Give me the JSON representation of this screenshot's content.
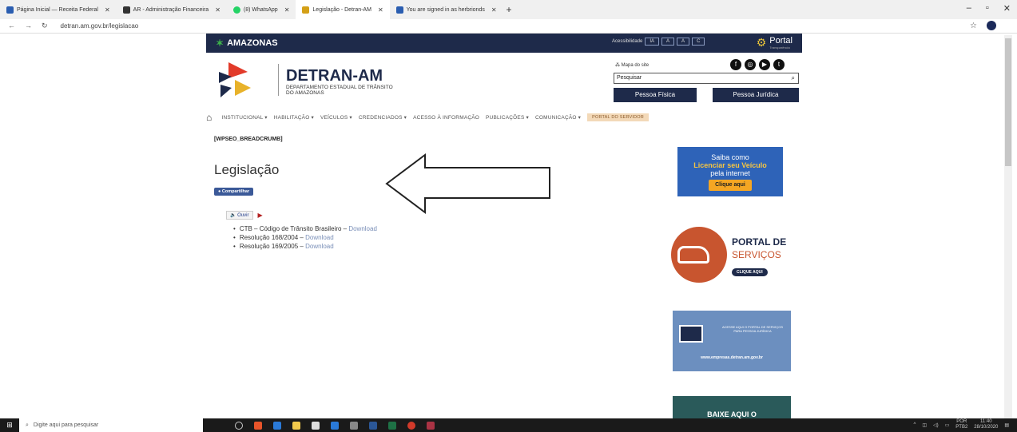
{
  "browser": {
    "tabs": [
      {
        "title": "Página Inicial — Receita Federal",
        "color": "#2a5db0"
      },
      {
        "title": "AR - Administração Financeira",
        "color": "#333333"
      },
      {
        "title": "(8) WhatsApp",
        "color": "#25d366"
      },
      {
        "title": "Legislação - Detran-AM",
        "color": "#d4a017"
      },
      {
        "title": "You are signed in as herbrionds",
        "color": "#2a5db0"
      }
    ],
    "url": "detran.am.gov.br/legislacao"
  },
  "topbar": {
    "brand": "AMAZONAS",
    "accessibility_label": "Acessibilidade",
    "access_buttons": [
      "IA",
      "A",
      "A",
      "C"
    ],
    "portal_label": "Portal",
    "portal_sub": "Transparência"
  },
  "header": {
    "title": "DETRAN-AM",
    "subtitle": "DEPARTAMENTO ESTADUAL DE TRÂNSITO DO AMAZONAS",
    "site_map": "Mapa do site",
    "search_placeholder": "Pesquisar",
    "btn_pf": "Pessoa Física",
    "btn_pj": "Pessoa Jurídica"
  },
  "menu": {
    "items": [
      "INSTITUCIONAL ▾",
      "HABILITAÇÃO ▾",
      "VEÍCULOS ▾",
      "CREDENCIADOS ▾",
      "ACESSO À INFORMAÇÃO",
      "PUBLICAÇÕES ▾",
      "COMUNICAÇÃO ▾"
    ],
    "servidor": "PORTAL DO SERVIDOR"
  },
  "content": {
    "breadcrumb": "[WPSEO_BREADCRUMB]",
    "title": "Legislação",
    "share": "Compartilhar",
    "ouvir": "Ouvir",
    "items": [
      {
        "text": "CTB – Código de Trânsito Brasileiro – ",
        "link": "Download"
      },
      {
        "text": "Resolução 168/2004 – ",
        "link": "Download"
      },
      {
        "text": "Resolução 169/2005 – ",
        "link": "Download"
      }
    ]
  },
  "sidebar": {
    "banner1": {
      "line1": "Saiba como",
      "highlight": "Licenciar seu Veículo",
      "line3": "pela internet",
      "cta": "Clique aqui"
    },
    "banner2": {
      "title1": "PORTAL DE",
      "title2": "SERVIÇOS",
      "cta": "CLIQUE AQUI"
    },
    "banner3": {
      "text": "ACESSE AQUI O PORTAL DE SERVIÇOS PARA PESSOA JURÍDICA",
      "url": "www.empresas.detran.am.gov.br"
    },
    "banner4": {
      "text": "BAIXE AQUI O"
    }
  },
  "taskbar": {
    "search": "Digite aqui para pesquisar",
    "lang": "POR",
    "lang2": "PTB2",
    "time": "11:40",
    "date": "28/10/2020"
  }
}
